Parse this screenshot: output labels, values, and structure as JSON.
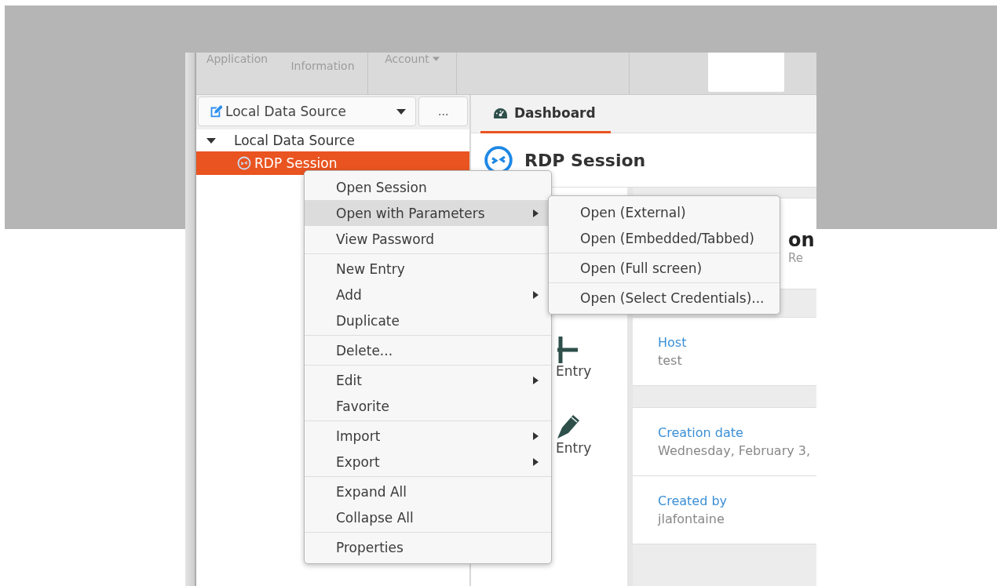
{
  "ribbon": {
    "groups": [
      {
        "label": "Application",
        "has_dropdown": false
      },
      {
        "label": "Information",
        "has_dropdown": false
      },
      {
        "label": "Account",
        "has_dropdown": true
      }
    ]
  },
  "data_source": {
    "value": "Local Data Source",
    "more_button": "..."
  },
  "tree": [
    {
      "label": "Local Data Source",
      "expanded": true,
      "selected": false,
      "children": [
        {
          "label": "RDP Session",
          "selected": true
        }
      ]
    }
  ],
  "tabs": [
    {
      "label": "Dashboard",
      "selected": true
    }
  ],
  "entry": {
    "title": "RDP Session"
  },
  "actions": [
    {
      "label": "Entry",
      "kind": "add"
    },
    {
      "label": "Entry",
      "kind": "edit"
    }
  ],
  "summary": {
    "title": "on",
    "subtitle": "Re"
  },
  "properties": [
    {
      "label": "Host",
      "value": "test"
    },
    {
      "label": "Creation date",
      "value": "Wednesday, February 3,"
    },
    {
      "label": "Created by",
      "value": "jlafontaine"
    }
  ],
  "context_menu": {
    "groups": [
      [
        {
          "label": "Open Session",
          "has_submenu": false,
          "selected": false
        },
        {
          "label": "Open with Parameters",
          "has_submenu": true,
          "selected": true
        },
        {
          "label": "View Password",
          "has_submenu": false,
          "selected": false
        }
      ],
      [
        {
          "label": "New Entry",
          "has_submenu": false,
          "selected": false
        },
        {
          "label": "Add",
          "has_submenu": true,
          "selected": false
        },
        {
          "label": "Duplicate",
          "has_submenu": false,
          "selected": false
        }
      ],
      [
        {
          "label": "Delete...",
          "has_submenu": false,
          "selected": false
        }
      ],
      [
        {
          "label": "Edit",
          "has_submenu": true,
          "selected": false
        },
        {
          "label": "Favorite",
          "has_submenu": false,
          "selected": false
        }
      ],
      [
        {
          "label": "Import",
          "has_submenu": true,
          "selected": false
        },
        {
          "label": "Export",
          "has_submenu": true,
          "selected": false
        }
      ],
      [
        {
          "label": "Expand All",
          "has_submenu": false,
          "selected": false
        },
        {
          "label": "Collapse All",
          "has_submenu": false,
          "selected": false
        }
      ],
      [
        {
          "label": "Properties",
          "has_submenu": false,
          "selected": false
        }
      ]
    ]
  },
  "submenu": {
    "groups": [
      [
        {
          "label": "Open (External)"
        },
        {
          "label": "Open (Embedded/Tabbed)"
        }
      ],
      [
        {
          "label": "Open (Full screen)"
        }
      ],
      [
        {
          "label": "Open (Select Credentials)..."
        }
      ]
    ]
  }
}
